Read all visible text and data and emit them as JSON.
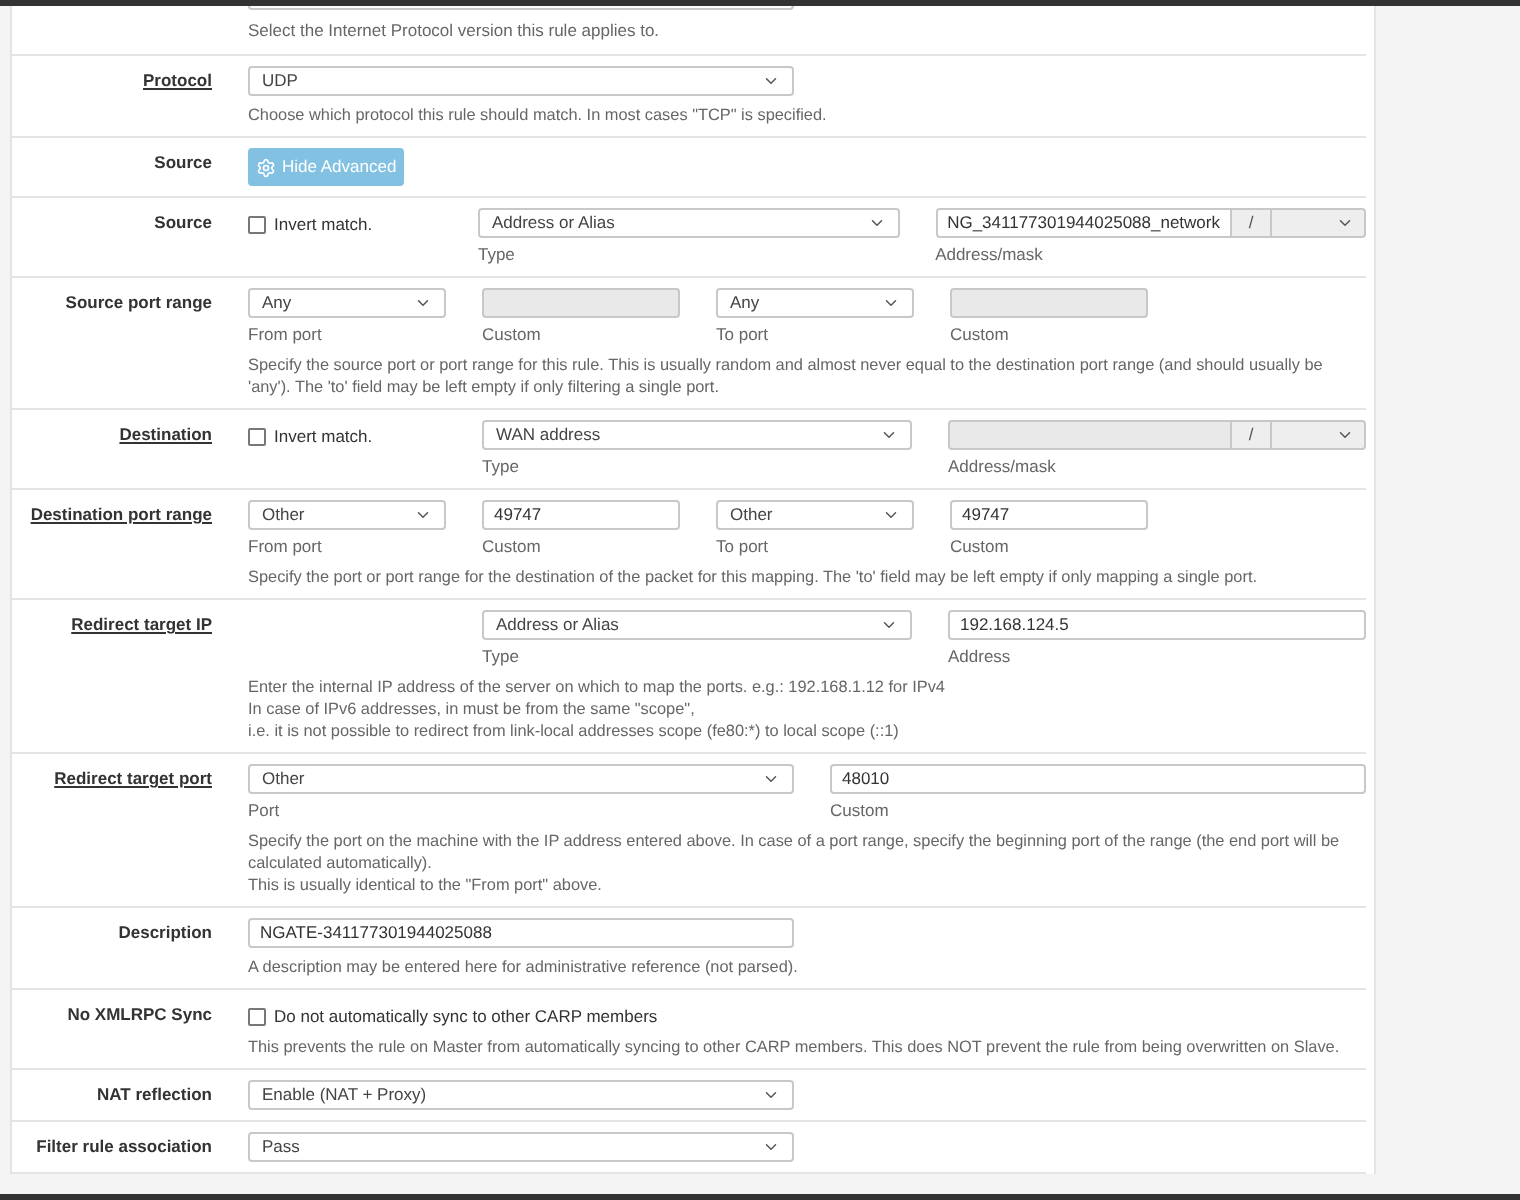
{
  "rows": [
    {
      "kind": "hint_only",
      "hint": "Select the Internet Protocol version this rule applies to."
    },
    {
      "kind": "select",
      "label": "Protocol",
      "underlined": true,
      "value": "UDP",
      "hint": "Choose which protocol this rule should match. In most cases \"TCP\" is specified."
    },
    {
      "kind": "button",
      "label": "Source",
      "underlined": false,
      "button": "Hide Advanced"
    },
    {
      "kind": "address",
      "label": "Source",
      "underlined": false,
      "invert": {
        "label": "Invert match.",
        "checked": false
      },
      "type": {
        "value": "Address or Alias",
        "caption": "Type"
      },
      "address": {
        "value": "NG_341177301944025088_network",
        "disabled": false,
        "caption": "Address/mask",
        "separator": "/"
      }
    },
    {
      "kind": "ports",
      "label": "Source port range",
      "underlined": false,
      "from": {
        "value": "Any",
        "caption": "From port"
      },
      "from_custom": {
        "disabled": true,
        "caption": "Custom"
      },
      "to": {
        "value": "Any",
        "caption": "To port"
      },
      "to_custom": {
        "disabled": true,
        "caption": "Custom"
      },
      "hint": [
        "Specify the source port or port range for this rule. This is usually random and almost never equal to the destination port range (and should usually be 'any'). The 'to' field may be left empty if only filtering a single port."
      ]
    },
    {
      "kind": "address",
      "label": "Destination",
      "underlined": true,
      "invert": {
        "label": "Invert match.",
        "checked": false
      },
      "type": {
        "value": "WAN address",
        "caption": "Type"
      },
      "address": {
        "disabled": true,
        "caption": "Address/mask",
        "separator": "/"
      }
    },
    {
      "kind": "ports",
      "label": "Destination port range",
      "underlined": true,
      "from": {
        "value": "Other",
        "caption": "From port"
      },
      "from_custom": {
        "value": "49747",
        "disabled": false,
        "caption": "Custom"
      },
      "to": {
        "value": "Other",
        "caption": "To port"
      },
      "to_custom": {
        "value": "49747",
        "disabled": false,
        "caption": "Custom"
      },
      "hint": [
        "Specify the port or port range for the destination of the packet for this mapping. The 'to' field may be left empty if only mapping a single port."
      ]
    },
    {
      "kind": "address",
      "label": "Redirect target IP",
      "underlined": true,
      "type": {
        "value": "Address or Alias",
        "caption": "Type"
      },
      "address": {
        "value": "192.168.124.5",
        "disabled": false,
        "caption": "Address"
      },
      "hint": [
        "Enter the internal IP address of the server on which to map the ports. e.g.: 192.168.1.12 for IPv4",
        "In case of IPv6 addresses, in must be from the same \"scope\",",
        "i.e. it is not possible to redirect from link-local addresses scope (fe80:*) to local scope (::1)"
      ]
    },
    {
      "kind": "port_pair",
      "label": "Redirect target port",
      "underlined": true,
      "port": {
        "value": "Other",
        "caption": "Port"
      },
      "custom": {
        "value": "48010",
        "caption": "Custom"
      },
      "hint": [
        "Specify the port on the machine with the IP address entered above. In case of a port range, specify the beginning port of the range (the end port will be calculated automatically).",
        "This is usually identical to the \"From port\" above."
      ]
    },
    {
      "kind": "text",
      "label": "Description",
      "underlined": false,
      "value": "NGATE-341177301944025088",
      "hint": "A description may be entered here for administrative reference (not parsed)."
    },
    {
      "kind": "checkbox",
      "label": "No XMLRPC Sync",
      "underlined": false,
      "text": "Do not automatically sync to other CARP members",
      "checked": false,
      "hint": "This prevents the rule on Master from automatically syncing to other CARP members. This does NOT prevent the rule from being overwritten on Slave."
    },
    {
      "kind": "select",
      "label": "NAT reflection",
      "underlined": false,
      "value": "Enable (NAT + Proxy)"
    },
    {
      "kind": "select",
      "label": "Filter rule association",
      "underlined": false,
      "value": "Pass"
    }
  ]
}
